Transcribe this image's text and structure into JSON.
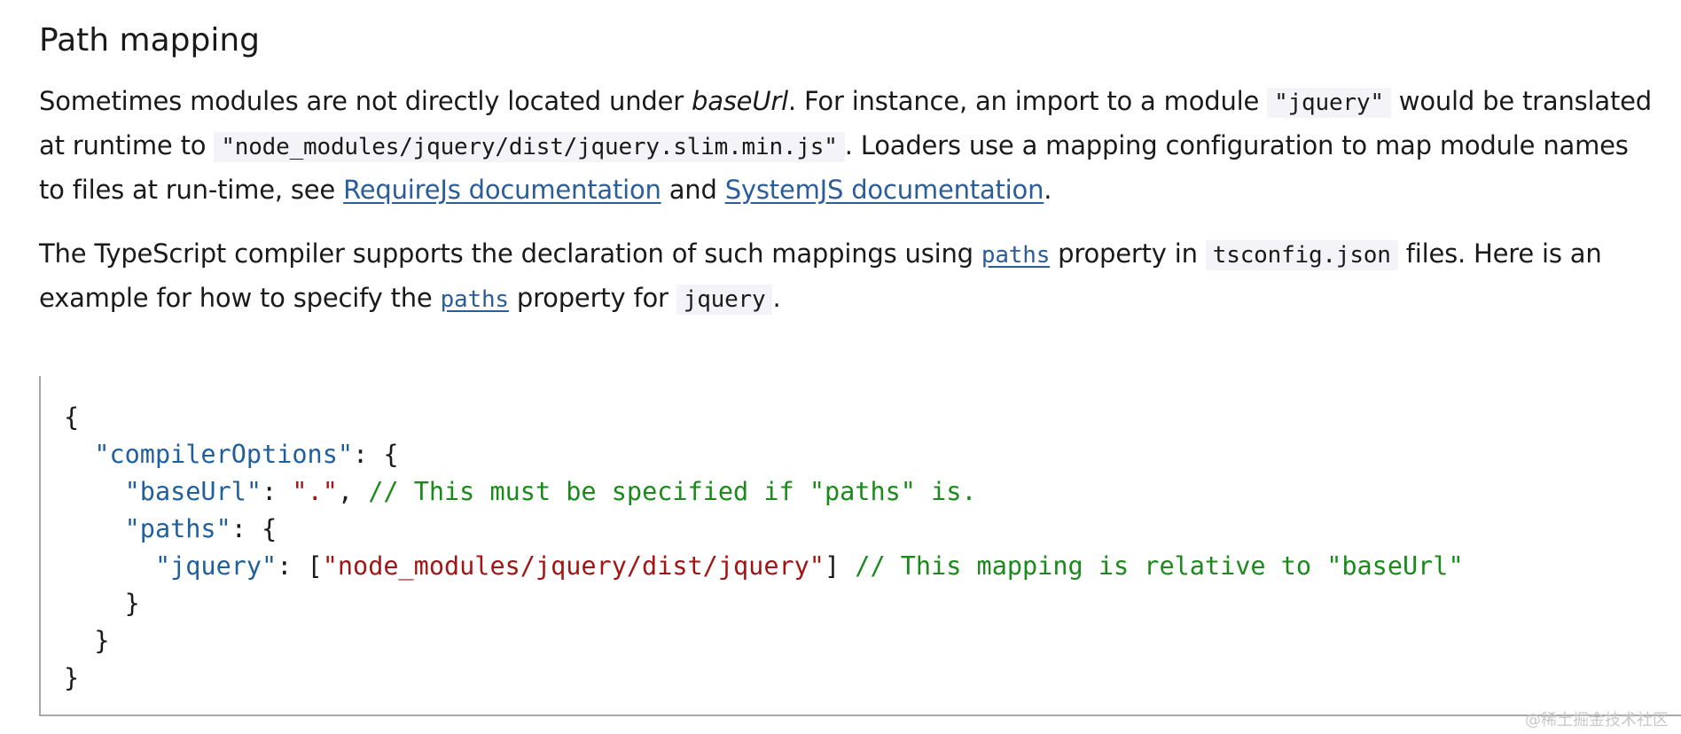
{
  "heading": "Path mapping",
  "para1": {
    "t1": "Sometimes modules are not directly located under ",
    "em1": "baseUrl",
    "t2": ". For instance, an import to a module ",
    "code1": "\"jquery\"",
    "t3": " would be translated at runtime to ",
    "code2": "\"node_modules/jquery/dist/jquery.slim.min.js\"",
    "t4": ". Loaders use a mapping configuration to map module names to files at run-time, see ",
    "link1": "RequireJs documentation",
    "t5": " and ",
    "link2": "SystemJS documentation",
    "t6": "."
  },
  "para2": {
    "t1": "The TypeScript compiler supports the declaration of such mappings using ",
    "link1": "paths",
    "t2": " property in ",
    "code1": "tsconfig.json",
    "t3": " files. Here is an example for how to specify the ",
    "link2": "paths",
    "t4": " property for ",
    "code2": "jquery",
    "t5": "."
  },
  "code": {
    "l1_p": "{",
    "l2_ind": "  ",
    "l2_k": "\"compilerOptions\"",
    "l2_p": ": {",
    "l3_ind": "    ",
    "l3_k": "\"baseUrl\"",
    "l3_p1": ": ",
    "l3_s": "\".\"",
    "l3_p2": ", ",
    "l3_c": "// This must be specified if \"paths\" is.",
    "l4_ind": "    ",
    "l4_k": "\"paths\"",
    "l4_p": ": {",
    "l5_ind": "      ",
    "l5_k": "\"jquery\"",
    "l5_p1": ": [",
    "l5_s": "\"node_modules/jquery/dist/jquery\"",
    "l5_p2": "] ",
    "l5_c": "// This mapping is relative to \"baseUrl\"",
    "l6_p": "    }",
    "l7_p": "  }",
    "l8_p": "}"
  },
  "watermark": "@稀土掘金技术社区"
}
